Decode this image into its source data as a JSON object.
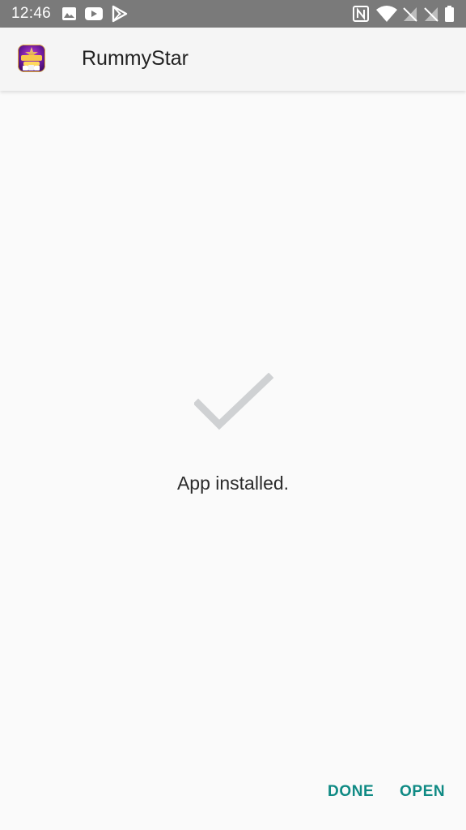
{
  "status_bar": {
    "time": "12:46",
    "icons": [
      "image-icon",
      "youtube-icon",
      "play-store-icon",
      "nfc-icon",
      "wifi-icon",
      "signal-off-icon",
      "signal-off-icon",
      "battery-icon"
    ]
  },
  "app_bar": {
    "title": "RummyStar",
    "icon": "rummystar-app-icon"
  },
  "content": {
    "status_icon": "checkmark-icon",
    "message": "App installed."
  },
  "actions": {
    "done_label": "DONE",
    "open_label": "OPEN"
  },
  "colors": {
    "status_bar": "#7a7a7a",
    "accent": "#0f8a84",
    "checkmark": "#cfd1d3",
    "background": "#fafafa"
  }
}
